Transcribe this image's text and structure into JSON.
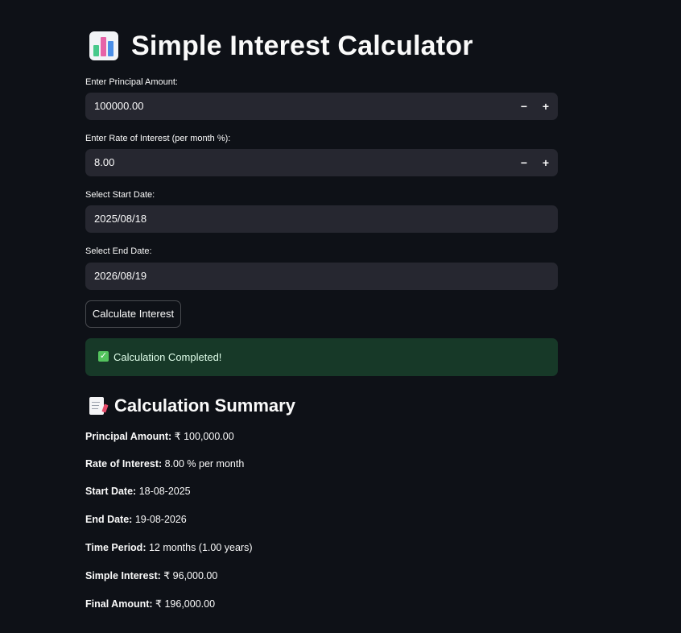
{
  "header": {
    "title": "Simple Interest Calculator",
    "icon": "bar-chart-icon"
  },
  "form": {
    "principal": {
      "label": "Enter Principal Amount:",
      "value": "100000.00",
      "minus": "−",
      "plus": "+"
    },
    "rate": {
      "label": "Enter Rate of Interest (per month %):",
      "value": "8.00",
      "minus": "−",
      "plus": "+"
    },
    "start_date": {
      "label": "Select Start Date:",
      "value": "2025/08/18"
    },
    "end_date": {
      "label": "Select End Date:",
      "value": "2026/08/19"
    },
    "submit_label": "Calculate Interest"
  },
  "alert": {
    "icon": "check-mark-icon",
    "text": "Calculation Completed!",
    "color": "#173928"
  },
  "summary": {
    "icon": "memo-icon",
    "title": "Calculation Summary",
    "items": [
      {
        "key": "Principal Amount:",
        "value": " ₹ 100,000.00"
      },
      {
        "key": "Rate of Interest:",
        "value": " 8.00 % per month"
      },
      {
        "key": "Start Date:",
        "value": " 18-08-2025"
      },
      {
        "key": "End Date:",
        "value": " 19-08-2026"
      },
      {
        "key": "Time Period:",
        "value": " 12 months (1.00 years)"
      },
      {
        "key": "Simple Interest:",
        "value": " ₹ 96,000.00"
      },
      {
        "key": "Final Amount:",
        "value": " ₹ 196,000.00"
      }
    ]
  },
  "colors": {
    "background": "#0e1117",
    "input_background": "#262730",
    "success_background": "#173928",
    "text": "#fafafa"
  }
}
